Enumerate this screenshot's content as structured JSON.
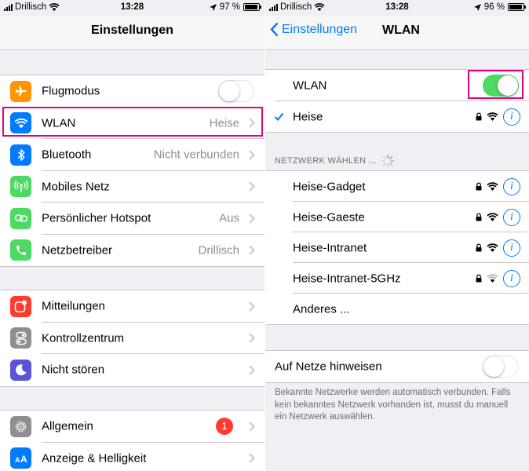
{
  "left": {
    "status": {
      "carrier": "Drillisch",
      "time": "13:28",
      "battery": "97 %",
      "battery_level": 0.97
    },
    "nav": {
      "title": "Einstellungen"
    },
    "groups": [
      [
        {
          "icon": "airplane-icon",
          "color": "#ff9500",
          "label": "Flugmodus",
          "value": "",
          "control": "toggle-off"
        },
        {
          "icon": "wifi-icon",
          "color": "#007aff",
          "label": "WLAN",
          "value": "Heise",
          "control": "chevron",
          "highlighted": true
        },
        {
          "icon": "bluetooth-icon",
          "color": "#007aff",
          "label": "Bluetooth",
          "value": "Nicht verbunden",
          "control": "chevron"
        },
        {
          "icon": "antenna-icon",
          "color": "#4cd964",
          "label": "Mobiles Netz",
          "value": "",
          "control": "chevron"
        },
        {
          "icon": "hotspot-icon",
          "color": "#4cd964",
          "label": "Persönlicher Hotspot",
          "value": "Aus",
          "control": "chevron"
        },
        {
          "icon": "phone-icon",
          "color": "#4cd964",
          "label": "Netzbetreiber",
          "value": "Drillisch",
          "control": "chevron"
        }
      ],
      [
        {
          "icon": "notifications-icon",
          "color": "#ff3b30",
          "label": "Mitteilungen",
          "value": "",
          "control": "chevron"
        },
        {
          "icon": "control-center-icon",
          "color": "#8e8e93",
          "label": "Kontrollzentrum",
          "value": "",
          "control": "chevron"
        },
        {
          "icon": "moon-icon",
          "color": "#5856d6",
          "label": "Nicht stören",
          "value": "",
          "control": "chevron"
        }
      ],
      [
        {
          "icon": "gear-icon",
          "color": "#8e8e93",
          "label": "Allgemein",
          "value": "",
          "badge": "1",
          "control": "chevron"
        },
        {
          "icon": "display-icon",
          "color": "#007aff",
          "label": "Anzeige & Helligkeit",
          "value": "",
          "control": "chevron"
        }
      ]
    ]
  },
  "right": {
    "status": {
      "carrier": "Drillisch",
      "time": "13:28",
      "battery": "96 %",
      "battery_level": 0.96
    },
    "nav": {
      "back": "Einstellungen",
      "title": "WLAN"
    },
    "wlan_label": "WLAN",
    "wlan_on": true,
    "connected": "Heise",
    "section_header": "NETZWERK WÄHLEN ...",
    "networks": [
      "Heise-Gadget",
      "Heise-Gaeste",
      "Heise-Intranet",
      "Heise-Intranet-5GHz"
    ],
    "other": "Anderes ...",
    "ask_label": "Auf Netze hinweisen",
    "ask_on": false,
    "footnote": "Bekannte Netzwerke werden automatisch verbunden. Falls kein bekanntes Netzwerk vorhanden ist, musst du manuell ein Netzwerk auswählen.",
    "highlight_color": "#e3007f",
    "accent": "#007aff"
  }
}
